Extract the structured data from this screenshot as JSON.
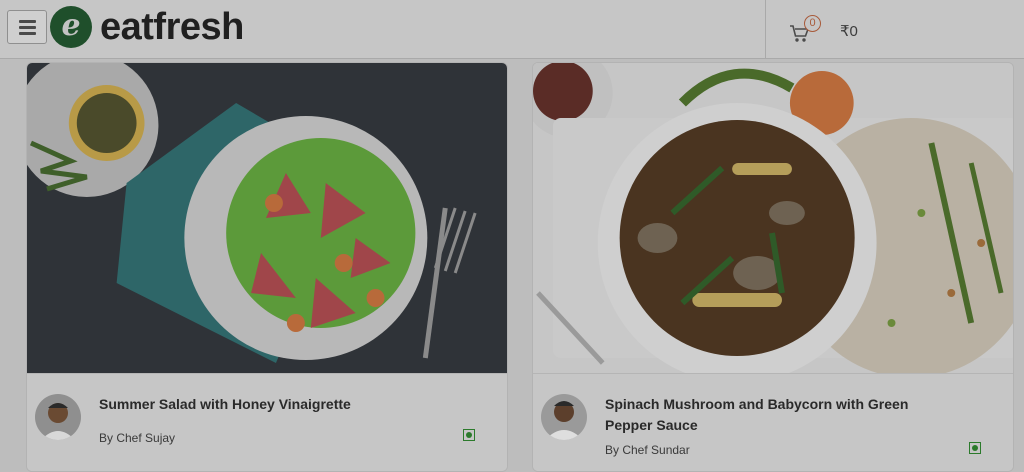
{
  "header": {
    "logo_letter": "e",
    "logo_text": "eatfresh",
    "cart_count": "0",
    "cart_total": "₹0",
    "menu_icon": "hamburger-menu-icon",
    "cart_icon": "shopping-cart-icon"
  },
  "recipes": [
    {
      "title": "Summer Salad with Honey Vinaigrette",
      "chef": "By Chef Sujay",
      "image": "summer-salad-photo",
      "badge": "veg-icon"
    },
    {
      "title": "Spinach Mushroom and Babycorn with Green Pepper Sauce",
      "chef": "By Chef Sundar",
      "image": "mushroom-babycorn-soup-photo",
      "badge": "veg-icon"
    }
  ],
  "colors": {
    "brand_green": "#1f4f2b",
    "veg_green": "#2b7a2b",
    "overlay": "#bdbdbd"
  }
}
